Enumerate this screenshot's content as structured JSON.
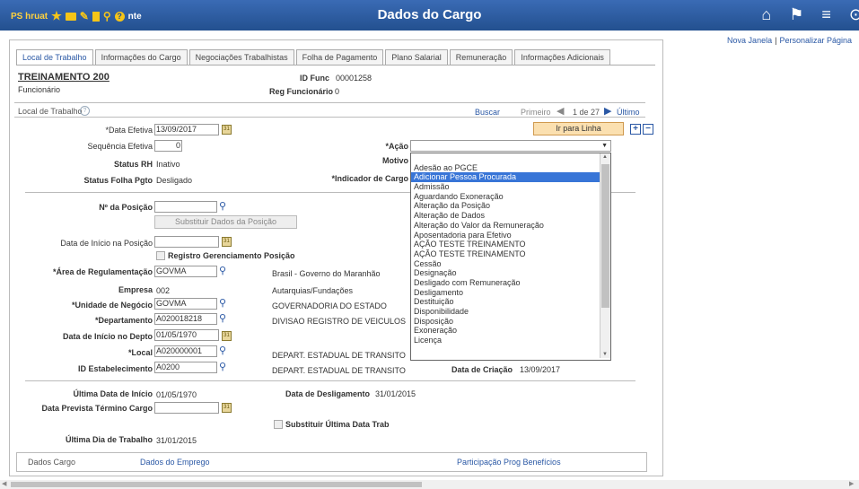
{
  "header": {
    "logo_text": "PS hruat",
    "app_suffix": "nte",
    "title": "Dados do Cargo",
    "icons": [
      "star-icon",
      "folder-icon",
      "pencil-icon",
      "document-icon",
      "search-icon",
      "help-icon",
      "home-icon",
      "flag-icon",
      "menu-icon",
      "navbar-icon"
    ]
  },
  "links": {
    "new_window": "Nova Janela",
    "personalize": "Personalizar Página"
  },
  "tabs": [
    "Local de Trabalho",
    "Informações do Cargo",
    "Negociações Trabalhistas",
    "Folha de Pagamento",
    "Plano Salarial",
    "Remuneração",
    "Informações Adicionais"
  ],
  "employee": {
    "name": "TREINAMENTO 200",
    "role": "Funcionário",
    "id_label": "ID Func",
    "id_value": "00001258",
    "reg_label": "Reg Funcionário",
    "reg_value": "0"
  },
  "section": {
    "title": "Local de Trabalho",
    "search": "Buscar",
    "first": "Primeiro",
    "count": "1 de 27",
    "last": "Último",
    "goto_button": "Ir para Linha"
  },
  "fields": {
    "data_efetiva_label": "*Data Efetiva",
    "data_efetiva_value": "13/09/2017",
    "sequencia_label": "Sequência Efetiva",
    "sequencia_value": "0",
    "status_rh_label": "Status RH",
    "status_rh_value": "Inativo",
    "status_folha_label": "Status Folha Pgto",
    "status_folha_value": "Desligado",
    "acao_label": "*Ação",
    "motivo_label": "Motivo",
    "indicador_label": "*Indicador de Cargo",
    "posicao_label": "Nº da Posição",
    "substituir_button": "Substituir Dados da Posição",
    "inicio_posicao_label": "Data de Início na Posição",
    "registro_label": "Registro Gerenciamento Posição",
    "area_label": "*Área de Regulamentação",
    "area_value": "GOVMA",
    "area_desc": "Brasil - Governo do Maranhão",
    "empresa_label": "Empresa",
    "empresa_value": "002",
    "empresa_desc": "Autarquias/Fundações",
    "unidade_label": "*Unidade de Negócio",
    "unidade_value": "GOVMA",
    "unidade_desc": "GOVERNADORIA DO ESTADO",
    "departamento_label": "*Departamento",
    "departamento_value": "A020018218",
    "departamento_desc": "DIVISAO REGISTRO DE VEICULOS",
    "inicio_depto_label": "Data de Início no Depto",
    "inicio_depto_value": "01/05/1970",
    "local_label": "*Local",
    "local_value": "A020000001",
    "local_desc": "DEPART. ESTADUAL DE TRANSITO",
    "estab_label": "ID Estabelecimento",
    "estab_value": "A0200",
    "estab_desc": "DEPART. ESTADUAL DE TRANSITO",
    "criacao_label": "Data de Criação",
    "criacao_value": "13/09/2017",
    "ultima_inicio_label": "Última Data de Início",
    "ultima_inicio_value": "01/05/1970",
    "desligamento_label": "Data de Desligamento",
    "desligamento_value": "31/01/2015",
    "prevista_label": "Data Prevista Término Cargo",
    "substituir_ultima_label": "Substituir Última Data Trab",
    "ultimo_dia_label": "Última Dia de Trabalho",
    "ultimo_dia_value": "31/01/2015"
  },
  "dropdown_options": [
    "",
    "Adesão ao PGCE",
    "Adicionar Pessoa Procurada",
    "Admissão",
    "Aguardando Exoneração",
    "Alteração da Posição",
    "Alteração de Dados",
    "Alteração do Valor da Remuneração",
    "Aposentadoria para Efetivo",
    "AÇÃO TESTE TREINAMENTO",
    "AÇÃO TESTE TREINAMENTO",
    "Cessão",
    "Designação",
    "Desligado com Remuneração",
    "Desligamento",
    "Destituição",
    "Disponibilidade",
    "Disposição",
    "Exoneração",
    "Licença"
  ],
  "dropdown_selected": "Adicionar Pessoa Procurada",
  "footer": {
    "label": "Dados Cargo",
    "link1": "Dados do Emprego",
    "link2": "Participação Prog Benefícios"
  }
}
